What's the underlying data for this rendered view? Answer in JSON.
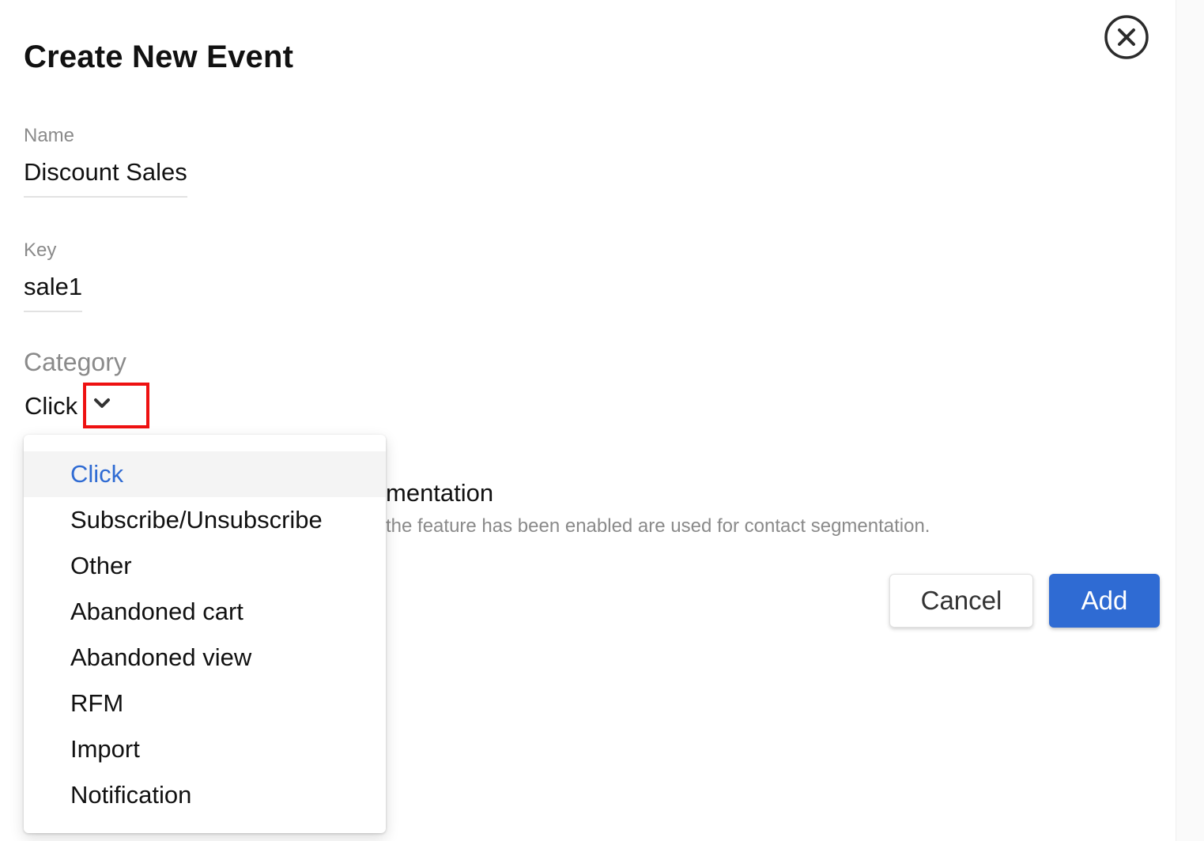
{
  "dialog": {
    "title": "Create New Event"
  },
  "fields": {
    "name_label": "Name",
    "name_value": "Discount Sales",
    "key_label": "Key",
    "key_value": "sale1",
    "category_label": "Category",
    "category_value": "Click"
  },
  "segmentation": {
    "title_visible": "mentation",
    "description_visible": "the feature has been enabled are used for contact segmentation."
  },
  "buttons": {
    "cancel_label": "Cancel",
    "add_label": "Add"
  },
  "dropdown": {
    "options": [
      {
        "label": "Click",
        "selected": true
      },
      {
        "label": "Subscribe/Unsubscribe",
        "selected": false
      },
      {
        "label": "Other",
        "selected": false
      },
      {
        "label": "Abandoned cart",
        "selected": false
      },
      {
        "label": "Abandoned view",
        "selected": false
      },
      {
        "label": "RFM",
        "selected": false
      },
      {
        "label": "Import",
        "selected": false
      },
      {
        "label": "Notification",
        "selected": false
      }
    ]
  },
  "icons": {
    "close": "close-circle-icon",
    "chevron": "chevron-down-icon"
  },
  "colors": {
    "accent": "#2f6bd3",
    "highlight_box": "#ee1111",
    "muted_text": "#8a8a8a"
  }
}
